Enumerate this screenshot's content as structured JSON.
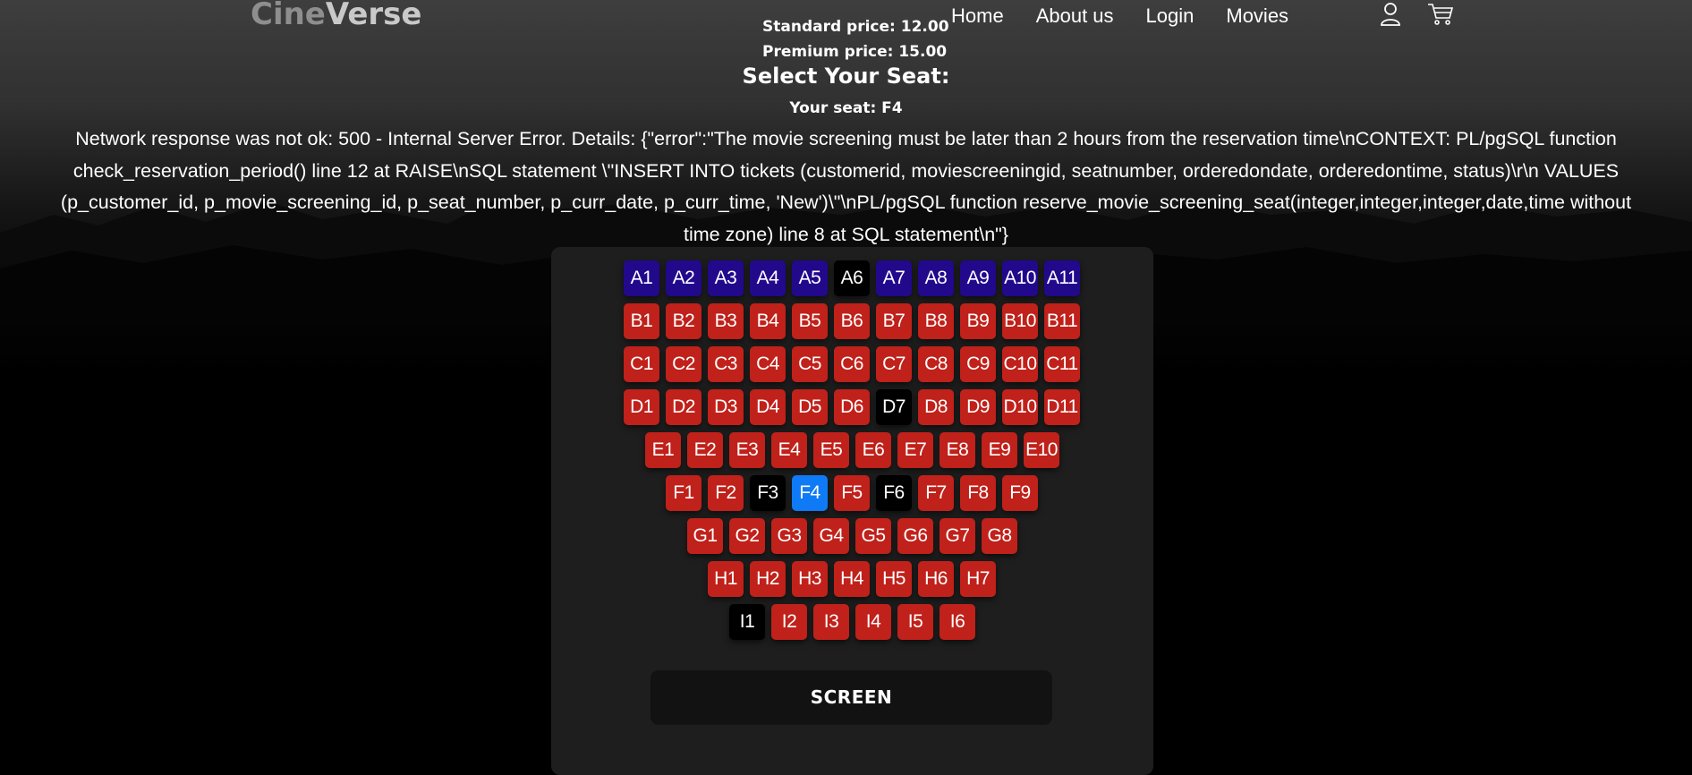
{
  "brand": {
    "part1": "Cine",
    "part2": "Verse"
  },
  "prices": {
    "standard": "Standard price: 12.00",
    "premium": "Premium price: 15.00"
  },
  "nav": {
    "home": "Home",
    "about": "About us",
    "login": "Login",
    "movies": "Movies"
  },
  "icons": {
    "user": "user-icon",
    "cart": "cart-icon"
  },
  "title": "Select Your Seat:",
  "your_seat": "Your seat: F4",
  "error_message": "Network response was not ok: 500 - Internal Server Error. Details: {\"error\":\"The movie screening must be later than 2 hours from the reservation time\\nCONTEXT: PL/pgSQL function check_reservation_period() line 12 at RAISE\\nSQL statement \\\"INSERT INTO tickets (customerid, moviescreeningid, seatnumber, orderedondate, orderedontime, status)\\r\\n VALUES (p_customer_id, p_movie_screening_id, p_seat_number, p_curr_date, p_curr_time, 'New')\\\"\\nPL/pgSQL function reserve_movie_screening_seat(integer,integer,integer,date,time without time zone) line 8 at SQL statement\\n\"}",
  "screen_label": "SCREEN",
  "colors": {
    "premium": "#22098c",
    "standard": "#c0211a",
    "taken": "#000000",
    "selected": "#0f7af5",
    "panel": "#1e1e1e"
  },
  "seat_rows": [
    {
      "row": "A",
      "seats": [
        {
          "label": "A1",
          "status": "premium"
        },
        {
          "label": "A2",
          "status": "premium"
        },
        {
          "label": "A3",
          "status": "premium"
        },
        {
          "label": "A4",
          "status": "premium"
        },
        {
          "label": "A5",
          "status": "premium"
        },
        {
          "label": "A6",
          "status": "taken"
        },
        {
          "label": "A7",
          "status": "premium"
        },
        {
          "label": "A8",
          "status": "premium"
        },
        {
          "label": "A9",
          "status": "premium"
        },
        {
          "label": "A10",
          "status": "premium"
        },
        {
          "label": "A11",
          "status": "premium"
        }
      ]
    },
    {
      "row": "B",
      "seats": [
        {
          "label": "B1",
          "status": "standard"
        },
        {
          "label": "B2",
          "status": "standard"
        },
        {
          "label": "B3",
          "status": "standard"
        },
        {
          "label": "B4",
          "status": "standard"
        },
        {
          "label": "B5",
          "status": "standard"
        },
        {
          "label": "B6",
          "status": "standard"
        },
        {
          "label": "B7",
          "status": "standard"
        },
        {
          "label": "B8",
          "status": "standard"
        },
        {
          "label": "B9",
          "status": "standard"
        },
        {
          "label": "B10",
          "status": "standard"
        },
        {
          "label": "B11",
          "status": "standard"
        }
      ]
    },
    {
      "row": "C",
      "seats": [
        {
          "label": "C1",
          "status": "standard"
        },
        {
          "label": "C2",
          "status": "standard"
        },
        {
          "label": "C3",
          "status": "standard"
        },
        {
          "label": "C4",
          "status": "standard"
        },
        {
          "label": "C5",
          "status": "standard"
        },
        {
          "label": "C6",
          "status": "standard"
        },
        {
          "label": "C7",
          "status": "standard"
        },
        {
          "label": "C8",
          "status": "standard"
        },
        {
          "label": "C9",
          "status": "standard"
        },
        {
          "label": "C10",
          "status": "standard"
        },
        {
          "label": "C11",
          "status": "standard"
        }
      ]
    },
    {
      "row": "D",
      "seats": [
        {
          "label": "D1",
          "status": "standard"
        },
        {
          "label": "D2",
          "status": "standard"
        },
        {
          "label": "D3",
          "status": "standard"
        },
        {
          "label": "D4",
          "status": "standard"
        },
        {
          "label": "D5",
          "status": "standard"
        },
        {
          "label": "D6",
          "status": "standard"
        },
        {
          "label": "D7",
          "status": "taken"
        },
        {
          "label": "D8",
          "status": "standard"
        },
        {
          "label": "D9",
          "status": "standard"
        },
        {
          "label": "D10",
          "status": "standard"
        },
        {
          "label": "D11",
          "status": "standard"
        }
      ]
    },
    {
      "row": "E",
      "seats": [
        {
          "label": "E1",
          "status": "standard"
        },
        {
          "label": "E2",
          "status": "standard"
        },
        {
          "label": "E3",
          "status": "standard"
        },
        {
          "label": "E4",
          "status": "standard"
        },
        {
          "label": "E5",
          "status": "standard"
        },
        {
          "label": "E6",
          "status": "standard"
        },
        {
          "label": "E7",
          "status": "standard"
        },
        {
          "label": "E8",
          "status": "standard"
        },
        {
          "label": "E9",
          "status": "standard"
        },
        {
          "label": "E10",
          "status": "standard"
        }
      ]
    },
    {
      "row": "F",
      "seats": [
        {
          "label": "F1",
          "status": "standard"
        },
        {
          "label": "F2",
          "status": "standard"
        },
        {
          "label": "F3",
          "status": "taken"
        },
        {
          "label": "F4",
          "status": "selected"
        },
        {
          "label": "F5",
          "status": "standard"
        },
        {
          "label": "F6",
          "status": "taken"
        },
        {
          "label": "F7",
          "status": "standard"
        },
        {
          "label": "F8",
          "status": "standard"
        },
        {
          "label": "F9",
          "status": "standard"
        }
      ]
    },
    {
      "row": "G",
      "seats": [
        {
          "label": "G1",
          "status": "standard"
        },
        {
          "label": "G2",
          "status": "standard"
        },
        {
          "label": "G3",
          "status": "standard"
        },
        {
          "label": "G4",
          "status": "standard"
        },
        {
          "label": "G5",
          "status": "standard"
        },
        {
          "label": "G6",
          "status": "standard"
        },
        {
          "label": "G7",
          "status": "standard"
        },
        {
          "label": "G8",
          "status": "standard"
        }
      ]
    },
    {
      "row": "H",
      "seats": [
        {
          "label": "H1",
          "status": "standard"
        },
        {
          "label": "H2",
          "status": "standard"
        },
        {
          "label": "H3",
          "status": "standard"
        },
        {
          "label": "H4",
          "status": "standard"
        },
        {
          "label": "H5",
          "status": "standard"
        },
        {
          "label": "H6",
          "status": "standard"
        },
        {
          "label": "H7",
          "status": "standard"
        }
      ]
    },
    {
      "row": "I",
      "seats": [
        {
          "label": "I1",
          "status": "taken"
        },
        {
          "label": "I2",
          "status": "standard"
        },
        {
          "label": "I3",
          "status": "standard"
        },
        {
          "label": "I4",
          "status": "standard"
        },
        {
          "label": "I5",
          "status": "standard"
        },
        {
          "label": "I6",
          "status": "standard"
        }
      ]
    }
  ]
}
